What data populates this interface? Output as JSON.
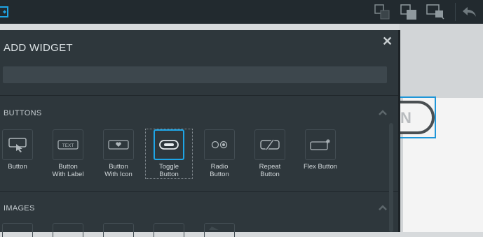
{
  "dialog": {
    "title": "ADD WIDGET",
    "search": {
      "value": "",
      "placeholder": ""
    },
    "sections": [
      {
        "title": "BUTTONS",
        "items": [
          {
            "label_line1": "Button",
            "label_line2": "",
            "icon": "button-icon"
          },
          {
            "label_line1": "Button",
            "label_line2": "With Label",
            "icon": "text-label-icon",
            "icon_text": "TEXT"
          },
          {
            "label_line1": "Button",
            "label_line2": "With Icon",
            "icon": "heart-button-icon"
          },
          {
            "label_line1": "Toggle",
            "label_line2": "Button",
            "icon": "toggle-icon",
            "selected": true
          },
          {
            "label_line1": "Radio",
            "label_line2": "Button",
            "icon": "radio-icon"
          },
          {
            "label_line1": "Repeat",
            "label_line2": "Button",
            "icon": "repeat-icon"
          },
          {
            "label_line1": "Flex Button",
            "label_line2": "",
            "icon": "flex-button-icon"
          }
        ]
      },
      {
        "title": "IMAGES",
        "items": []
      }
    ]
  },
  "preview": {
    "visible_text": "N"
  },
  "colors": {
    "accent": "#1ea5e6",
    "panel": "#2e373c",
    "toolbar": "#222a2f"
  }
}
